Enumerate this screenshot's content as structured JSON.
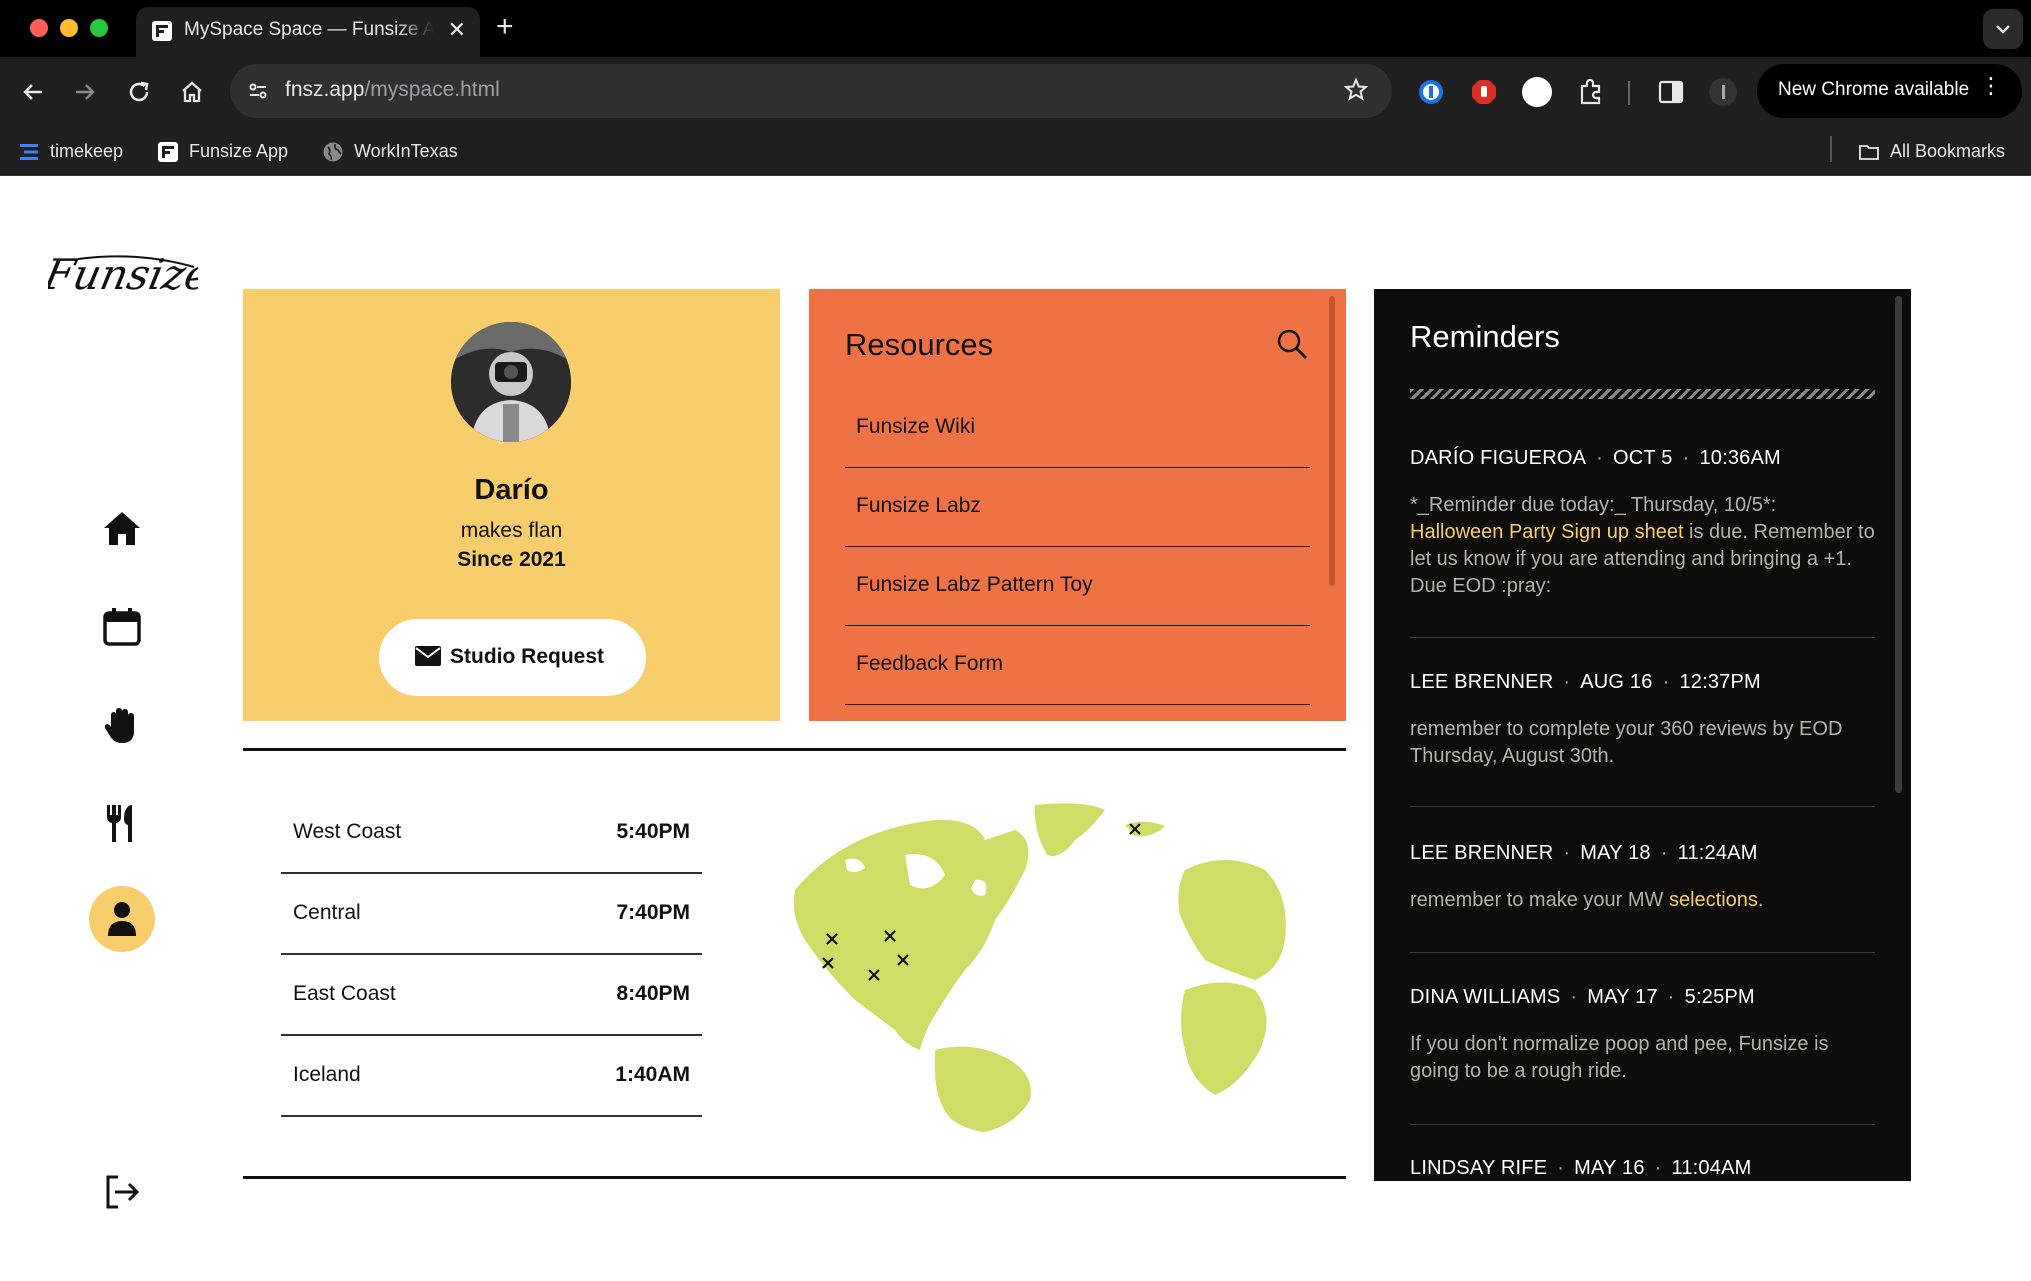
{
  "browser": {
    "tab_title": "MySpace Space — Funsize App",
    "url_host": "fnsz.app",
    "url_path": "/myspace.html",
    "new_chrome_label": "New Chrome available",
    "bookmarks": [
      {
        "label": "timekeep",
        "icon": "timekeep-icon"
      },
      {
        "label": "Funsize App",
        "icon": "funsize-icon"
      },
      {
        "label": "WorkInTexas",
        "icon": "globe-icon"
      }
    ],
    "all_bookmarks_label": "All Bookmarks"
  },
  "sidebar": {
    "logo_text": "Funsize",
    "items": [
      "home-icon",
      "calendar-icon",
      "hand-icon",
      "utensils-icon",
      "user-icon"
    ],
    "active_item": "user-icon",
    "logout_icon": "logout-icon"
  },
  "profile": {
    "name": "Darío",
    "tagline": "makes flan",
    "since": "Since 2021",
    "button_label": "Studio Request",
    "accent": "#f7ce6b"
  },
  "resources": {
    "title": "Resources",
    "items": [
      "Funsize Wiki",
      "Funsize Labz",
      "Funsize Labz Pattern Toy",
      "Feedback Form"
    ],
    "accent": "#ee7243"
  },
  "reminders": {
    "title": "Reminders",
    "items": [
      {
        "author": "DARÍO FIGUEROA",
        "date": "OCT 5",
        "time": "10:36AM",
        "body_pre": "*_Reminder due today:_ Thursday, 10/5*: ",
        "body_link": "Halloween Party Sign up sheet",
        "body_post": " is due. Remember to let us know if you are attending and bringing a +1. Due EOD :pray:"
      },
      {
        "author": "LEE BRENNER",
        "date": "AUG 16",
        "time": "12:37PM",
        "body_pre": "remember to complete your 360 reviews by EOD Thursday, August 30th.",
        "body_link": "",
        "body_post": ""
      },
      {
        "author": "LEE BRENNER",
        "date": "MAY 18",
        "time": "11:24AM",
        "body_pre": "remember to make your MW ",
        "body_link": "selections",
        "body_post": "."
      },
      {
        "author": "DINA WILLIAMS",
        "date": "MAY 17",
        "time": "5:25PM",
        "body_pre": "If you don't normalize poop and pee, Funsize is going to be a rough ride.",
        "body_link": "",
        "body_post": ""
      },
      {
        "author": "LINDSAY RIFE",
        "date": "MAY 16",
        "time": "11:04AM",
        "body_pre": "",
        "body_link": "",
        "body_post": ""
      }
    ],
    "highlight_color": "#f7ce6b"
  },
  "timezones": [
    {
      "name": "West Coast",
      "time": "5:40PM"
    },
    {
      "name": "Central",
      "time": "7:40PM"
    },
    {
      "name": "East Coast",
      "time": "8:40PM"
    },
    {
      "name": "Iceland",
      "time": "1:40AM"
    }
  ],
  "map": {
    "land_color": "#cfdc66",
    "marker": "x-mark"
  }
}
